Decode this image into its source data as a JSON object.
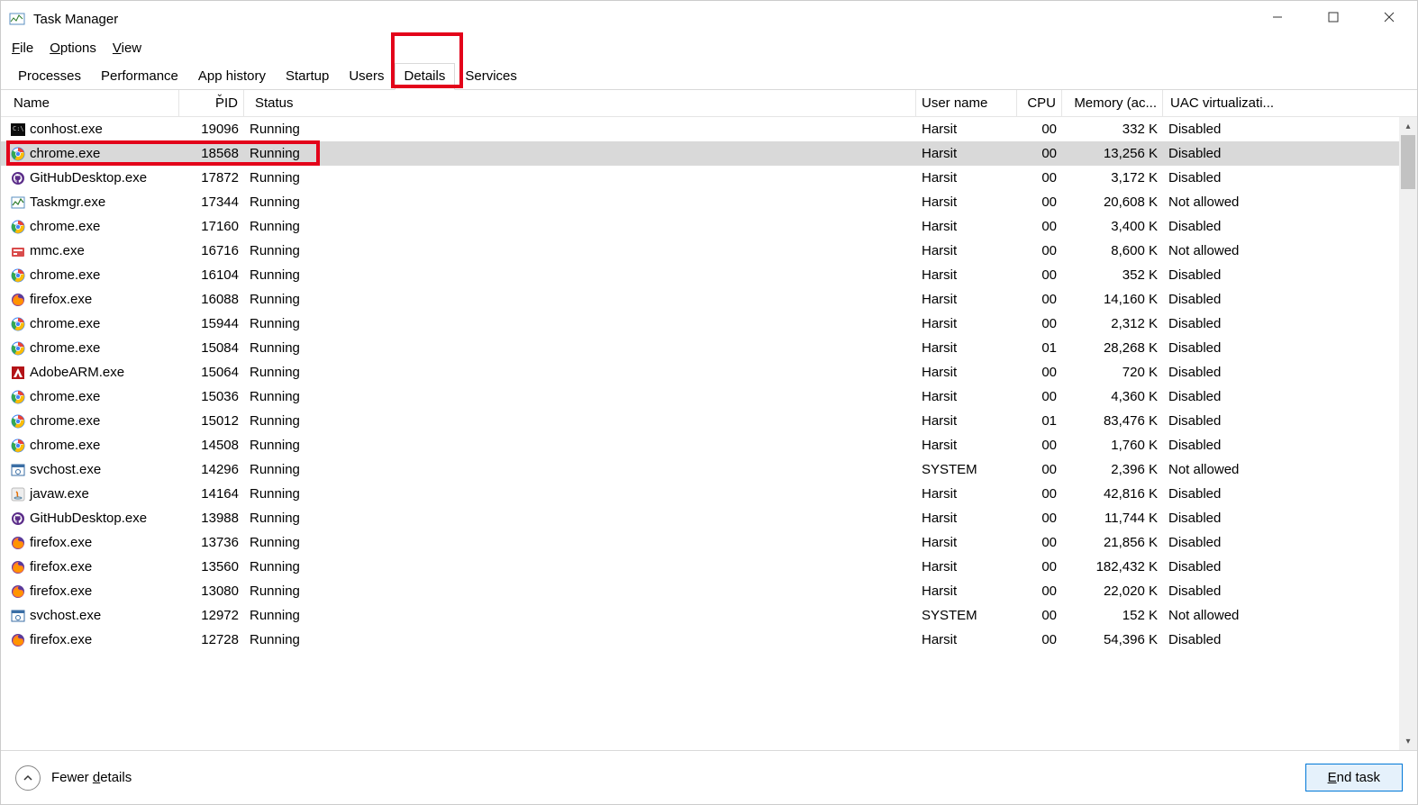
{
  "window": {
    "title": "Task Manager"
  },
  "menubar": [
    {
      "label": "File",
      "accel_index": 0
    },
    {
      "label": "Options",
      "accel_index": 0
    },
    {
      "label": "View",
      "accel_index": 0
    }
  ],
  "tabs": [
    {
      "label": "Processes",
      "active": false
    },
    {
      "label": "Performance",
      "active": false
    },
    {
      "label": "App history",
      "active": false
    },
    {
      "label": "Startup",
      "active": false
    },
    {
      "label": "Users",
      "active": false
    },
    {
      "label": "Details",
      "active": true
    },
    {
      "label": "Services",
      "active": false
    }
  ],
  "columns": {
    "name": "Name",
    "pid": "PID",
    "status": "Status",
    "user": "User name",
    "cpu": "CPU",
    "memory": "Memory (ac...",
    "uac": "UAC virtualizati..."
  },
  "sort": {
    "column": "pid",
    "direction": "desc"
  },
  "processes": [
    {
      "icon": "console",
      "name": "conhost.exe",
      "pid": "19096",
      "status": "Running",
      "user": "Harsit",
      "cpu": "00",
      "mem": "332 K",
      "uac": "Disabled",
      "selected": false
    },
    {
      "icon": "chrome",
      "name": "chrome.exe",
      "pid": "18568",
      "status": "Running",
      "user": "Harsit",
      "cpu": "00",
      "mem": "13,256 K",
      "uac": "Disabled",
      "selected": true
    },
    {
      "icon": "github",
      "name": "GitHubDesktop.exe",
      "pid": "17872",
      "status": "Running",
      "user": "Harsit",
      "cpu": "00",
      "mem": "3,172 K",
      "uac": "Disabled",
      "selected": false
    },
    {
      "icon": "taskmgr",
      "name": "Taskmgr.exe",
      "pid": "17344",
      "status": "Running",
      "user": "Harsit",
      "cpu": "00",
      "mem": "20,608 K",
      "uac": "Not allowed",
      "selected": false
    },
    {
      "icon": "chrome",
      "name": "chrome.exe",
      "pid": "17160",
      "status": "Running",
      "user": "Harsit",
      "cpu": "00",
      "mem": "3,400 K",
      "uac": "Disabled",
      "selected": false
    },
    {
      "icon": "mmc",
      "name": "mmc.exe",
      "pid": "16716",
      "status": "Running",
      "user": "Harsit",
      "cpu": "00",
      "mem": "8,600 K",
      "uac": "Not allowed",
      "selected": false
    },
    {
      "icon": "chrome",
      "name": "chrome.exe",
      "pid": "16104",
      "status": "Running",
      "user": "Harsit",
      "cpu": "00",
      "mem": "352 K",
      "uac": "Disabled",
      "selected": false
    },
    {
      "icon": "firefox",
      "name": "firefox.exe",
      "pid": "16088",
      "status": "Running",
      "user": "Harsit",
      "cpu": "00",
      "mem": "14,160 K",
      "uac": "Disabled",
      "selected": false
    },
    {
      "icon": "chrome",
      "name": "chrome.exe",
      "pid": "15944",
      "status": "Running",
      "user": "Harsit",
      "cpu": "00",
      "mem": "2,312 K",
      "uac": "Disabled",
      "selected": false
    },
    {
      "icon": "chrome",
      "name": "chrome.exe",
      "pid": "15084",
      "status": "Running",
      "user": "Harsit",
      "cpu": "01",
      "mem": "28,268 K",
      "uac": "Disabled",
      "selected": false
    },
    {
      "icon": "adobe",
      "name": "AdobeARM.exe",
      "pid": "15064",
      "status": "Running",
      "user": "Harsit",
      "cpu": "00",
      "mem": "720 K",
      "uac": "Disabled",
      "selected": false
    },
    {
      "icon": "chrome",
      "name": "chrome.exe",
      "pid": "15036",
      "status": "Running",
      "user": "Harsit",
      "cpu": "00",
      "mem": "4,360 K",
      "uac": "Disabled",
      "selected": false
    },
    {
      "icon": "chrome",
      "name": "chrome.exe",
      "pid": "15012",
      "status": "Running",
      "user": "Harsit",
      "cpu": "01",
      "mem": "83,476 K",
      "uac": "Disabled",
      "selected": false
    },
    {
      "icon": "chrome",
      "name": "chrome.exe",
      "pid": "14508",
      "status": "Running",
      "user": "Harsit",
      "cpu": "00",
      "mem": "1,760 K",
      "uac": "Disabled",
      "selected": false
    },
    {
      "icon": "svchost",
      "name": "svchost.exe",
      "pid": "14296",
      "status": "Running",
      "user": "SYSTEM",
      "cpu": "00",
      "mem": "2,396 K",
      "uac": "Not allowed",
      "selected": false
    },
    {
      "icon": "java",
      "name": "javaw.exe",
      "pid": "14164",
      "status": "Running",
      "user": "Harsit",
      "cpu": "00",
      "mem": "42,816 K",
      "uac": "Disabled",
      "selected": false
    },
    {
      "icon": "github",
      "name": "GitHubDesktop.exe",
      "pid": "13988",
      "status": "Running",
      "user": "Harsit",
      "cpu": "00",
      "mem": "11,744 K",
      "uac": "Disabled",
      "selected": false
    },
    {
      "icon": "firefox",
      "name": "firefox.exe",
      "pid": "13736",
      "status": "Running",
      "user": "Harsit",
      "cpu": "00",
      "mem": "21,856 K",
      "uac": "Disabled",
      "selected": false
    },
    {
      "icon": "firefox",
      "name": "firefox.exe",
      "pid": "13560",
      "status": "Running",
      "user": "Harsit",
      "cpu": "00",
      "mem": "182,432 K",
      "uac": "Disabled",
      "selected": false
    },
    {
      "icon": "firefox",
      "name": "firefox.exe",
      "pid": "13080",
      "status": "Running",
      "user": "Harsit",
      "cpu": "00",
      "mem": "22,020 K",
      "uac": "Disabled",
      "selected": false
    },
    {
      "icon": "svchost",
      "name": "svchost.exe",
      "pid": "12972",
      "status": "Running",
      "user": "SYSTEM",
      "cpu": "00",
      "mem": "152 K",
      "uac": "Not allowed",
      "selected": false
    },
    {
      "icon": "firefox",
      "name": "firefox.exe",
      "pid": "12728",
      "status": "Running",
      "user": "Harsit",
      "cpu": "00",
      "mem": "54,396 K",
      "uac": "Disabled",
      "selected": false
    }
  ],
  "footer": {
    "fewer_details": "Fewer details",
    "end_task": "End task"
  }
}
